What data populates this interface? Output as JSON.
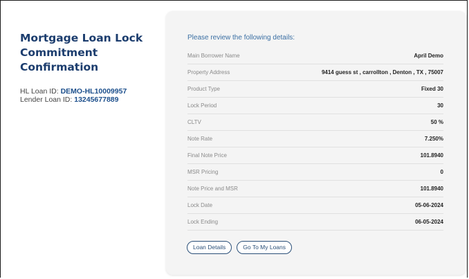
{
  "left": {
    "title_line1": "Mortgage Loan Lock",
    "title_line2": "Commitment Confirmation",
    "hl_label": "HL Loan ID:",
    "hl_value": "DEMO-HL10009957",
    "lender_label": "Lender Loan ID:",
    "lender_value": "13245677889"
  },
  "card": {
    "review_heading": "Please review the following details:",
    "rows": [
      {
        "label": "Main Borrower Name",
        "value": "April Demo"
      },
      {
        "label": "Property Address",
        "value": "9414 guess st , carrollton , Denton , TX , 75007"
      },
      {
        "label": "Product Type",
        "value": "Fixed 30"
      },
      {
        "label": "Lock Period",
        "value": "30"
      },
      {
        "label": "CLTV",
        "value": "50 %"
      },
      {
        "label": "Note Rate",
        "value": "7.250%"
      },
      {
        "label": "Final Note Price",
        "value": "101.8940"
      },
      {
        "label": "MSR Pricing",
        "value": "0"
      },
      {
        "label": "Note Price and MSR",
        "value": "101.8940"
      },
      {
        "label": "Lock Date",
        "value": "05-06-2024"
      },
      {
        "label": "Lock Ending",
        "value": "06-05-2024"
      }
    ],
    "buttons": {
      "loan_details": "Loan Details",
      "go_to_loans": "Go To My Loans"
    }
  }
}
